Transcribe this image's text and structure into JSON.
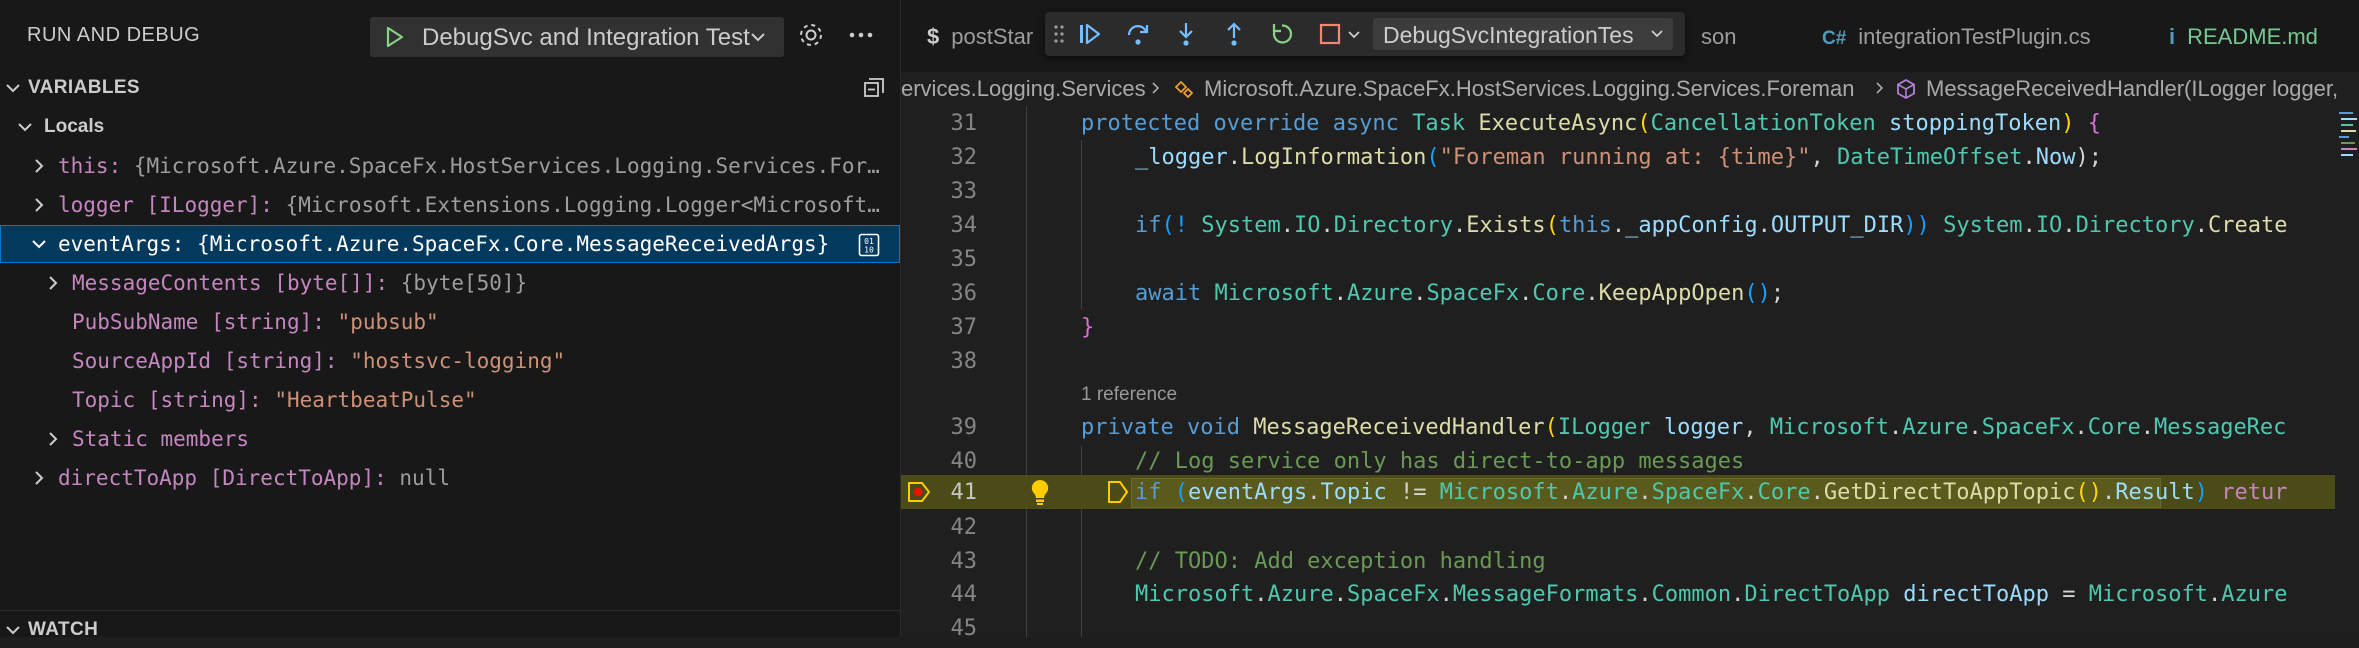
{
  "sidebar": {
    "title": "RUN AND DEBUG",
    "config_label": "DebugSvc and Integration Test",
    "variables_header": "VARIABLES",
    "locals_label": "Locals",
    "watch_header": "WATCH",
    "vars": [
      {
        "name": "this:",
        "type": "",
        "value": "{Microsoft.Azure.SpaceFx.HostServices.Logging.Services.For…"
      },
      {
        "name": "logger",
        "type": "[ILogger]:",
        "value": "{Microsoft.Extensions.Logging.Logger<Microsoft…"
      },
      {
        "name": "eventArgs:",
        "type": "",
        "value": "{Microsoft.Azure.SpaceFx.Core.MessageReceivedArgs}"
      },
      {
        "name": "MessageContents",
        "type": "[byte[]]:",
        "value": "{byte[50]}"
      },
      {
        "name": "PubSubName",
        "type": "[string]:",
        "value": "\"pubsub\""
      },
      {
        "name": "SourceAppId",
        "type": "[string]:",
        "value": "\"hostsvc-logging\""
      },
      {
        "name": "Topic",
        "type": "[string]:",
        "value": "\"HeartbeatPulse\""
      },
      {
        "name": "Static members",
        "type": "",
        "value": ""
      },
      {
        "name": "directToApp",
        "type": "[DirectToApp]:",
        "value": "null"
      }
    ]
  },
  "tabs": {
    "tab1": "postStar",
    "tab1_icon": "$",
    "tab2": "son",
    "tab3": "integrationTestPlugin.cs",
    "tab3_icon": "C#",
    "tab4": "README.md",
    "tab4_icon": "i",
    "debug_config": "DebugSvcIntegrationTes"
  },
  "breadcrumb": {
    "item1": "ervices.Logging.Services",
    "item2": "Microsoft.Azure.SpaceFx.HostServices.Logging.Services.Foreman",
    "item3": "MessageReceivedHandler(ILogger logger,"
  },
  "code": {
    "l31": {
      "n": "31",
      "t": [
        "protected",
        " ",
        "override",
        " ",
        "async",
        " ",
        "Task",
        " ",
        "ExecuteAsync",
        "(",
        "CancellationToken",
        " ",
        "stoppingToken",
        ")",
        " {"
      ]
    },
    "l32": {
      "n": "32",
      "t": [
        "_logger",
        ".",
        "LogInformation",
        "(",
        "\"Foreman running at: {time}\"",
        ", ",
        "DateTimeOffset",
        ".",
        "Now",
        ");"
      ]
    },
    "l33": {
      "n": "33"
    },
    "l34": {
      "n": "34",
      "t": [
        "if",
        "(! ",
        "System",
        ".",
        "IO",
        ".",
        "Directory",
        ".",
        "Exists",
        "(",
        "this",
        ".",
        "_appConfig",
        ".",
        "OUTPUT_DIR",
        "))",
        " ",
        "System",
        ".",
        "IO",
        ".",
        "Directory",
        ".",
        "Create"
      ]
    },
    "l35": {
      "n": "35"
    },
    "l36": {
      "n": "36",
      "t": [
        "await",
        " ",
        "Microsoft",
        ".",
        "Azure",
        ".",
        "SpaceFx",
        ".",
        "Core",
        ".",
        "KeepAppOpen",
        "()",
        ";"
      ]
    },
    "l37": {
      "n": "37",
      "t": [
        "}"
      ]
    },
    "l38": {
      "n": "38"
    },
    "codelens": "1 reference",
    "l39": {
      "n": "39",
      "t": [
        "private",
        " ",
        "void",
        " ",
        "MessageReceivedHandler",
        "(",
        "ILogger",
        " ",
        "logger",
        ", ",
        "Microsoft",
        ".",
        "Azure",
        ".",
        "SpaceFx",
        ".",
        "Core",
        ".",
        "MessageRec"
      ]
    },
    "l40": {
      "n": "40",
      "t": [
        "// Log service only has direct-to-app messages"
      ]
    },
    "l41": {
      "n": "41",
      "t": [
        "if",
        " (",
        "eventArgs",
        ".",
        "Topic",
        " != ",
        "Microsoft",
        ".",
        "Azure",
        ".",
        "SpaceFx",
        ".",
        "Core",
        ".",
        "GetDirectToAppTopic",
        "()",
        ".",
        "Result",
        ")",
        " ",
        "retur"
      ]
    },
    "l42": {
      "n": "42"
    },
    "l43": {
      "n": "43",
      "t": [
        "// TODO: Add exception handling"
      ]
    },
    "l44": {
      "n": "44",
      "t": [
        "Microsoft",
        ".",
        "Azure",
        ".",
        "SpaceFx",
        ".",
        "MessageFormats",
        ".",
        "Common",
        ".",
        "DirectToApp",
        " ",
        "directToApp",
        " = ",
        "Microsoft",
        ".",
        "Azure"
      ]
    },
    "l45": {
      "n": "45"
    }
  },
  "colors": {
    "accent": "#0078d4",
    "current_line": "#4b4b18",
    "breakpoint": "#e51400",
    "stmt_arrow": "#ffcc00"
  }
}
